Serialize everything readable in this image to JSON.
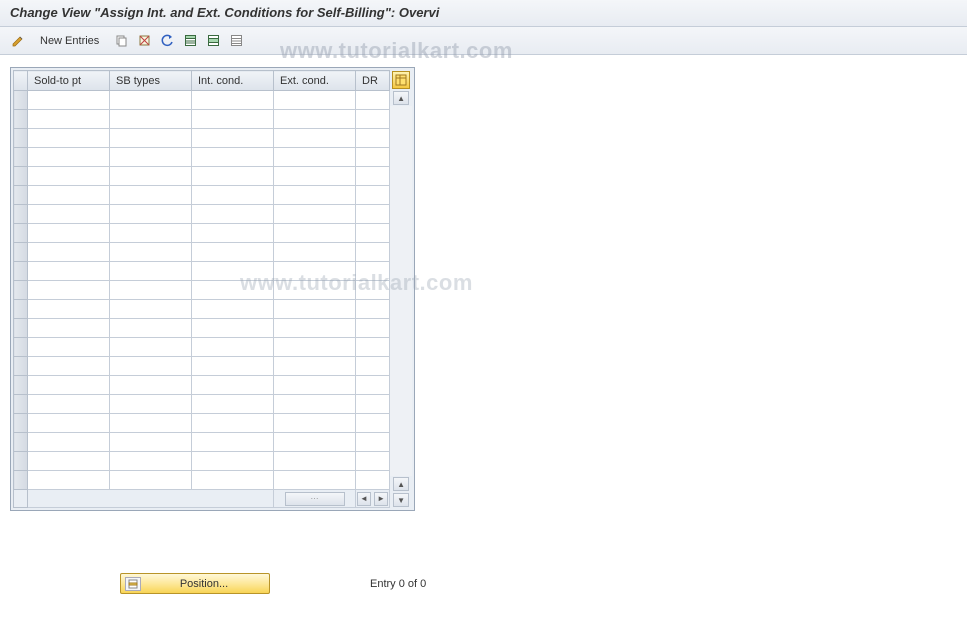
{
  "title": "Change View \"Assign Int. and Ext. Conditions for Self-Billing\": Overvi",
  "toolbar": {
    "new_entries_label": "New Entries"
  },
  "table": {
    "columns": {
      "sold_to_pt": "Sold-to pt",
      "sb_types": "SB types",
      "int_cond": "Int. cond.",
      "ext_cond": "Ext. cond.",
      "dr": "DR"
    },
    "visible_row_count": 21
  },
  "footer": {
    "position_label": "Position...",
    "entry_status": "Entry 0 of 0"
  },
  "watermark": "www.tutorialkart.com"
}
